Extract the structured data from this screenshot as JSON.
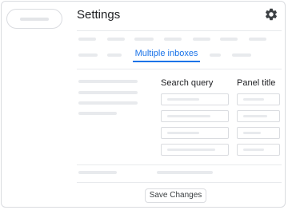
{
  "header": {
    "title": "Settings",
    "settings_icon": "gear-icon"
  },
  "tabs": {
    "active_label": "Multiple inboxes"
  },
  "table": {
    "columns": [
      "Search query",
      "Panel title"
    ]
  },
  "footer": {
    "save_label": "Save Changes"
  },
  "colors": {
    "accent": "#1a73e8",
    "text": "#202124",
    "placeholder": "#e8eaed",
    "border": "#dadce0"
  }
}
